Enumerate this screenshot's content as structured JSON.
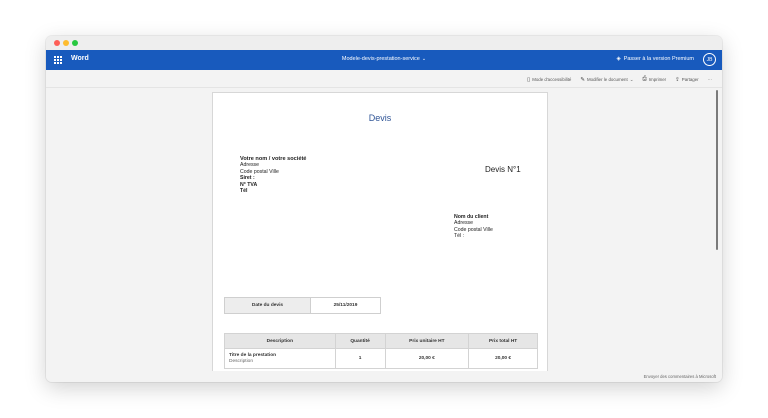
{
  "app": {
    "name": "Word",
    "document_title": "Modele-devis-prestation-service",
    "premium_label": "Passer à la version Premium",
    "avatar_initials": "JB"
  },
  "toolbar": {
    "accessibility": "Mode d'accessibilité",
    "edit": "Modifier le document",
    "print": "Imprimer",
    "share": "Partager",
    "more": "···"
  },
  "document": {
    "title": "Devis",
    "sender": {
      "name": "Votre nom / votre société",
      "address": "Adresse",
      "city": "Code postal  Ville",
      "siret": "Siret  :",
      "tva": "N° TVA",
      "tel": "Tél"
    },
    "devis_number": "Devis N°1",
    "client": {
      "name": "Nom  du client",
      "address": "Adresse",
      "city": "Code postal  Ville",
      "tel": "Tél :"
    },
    "date_label": "Date du devis",
    "date_value": "25/11/2019",
    "table": {
      "headers": [
        "Description",
        "Quantité",
        "Prix unitaire HT",
        "Prix total HT"
      ],
      "rows": [
        {
          "title": "Titre de la prestation",
          "description": "Description",
          "quantity": "1",
          "unit_price": "20,00 €",
          "total": "20,00 €"
        }
      ]
    }
  },
  "status": {
    "feedback": "Envoyer des commentaires à Microsoft"
  }
}
